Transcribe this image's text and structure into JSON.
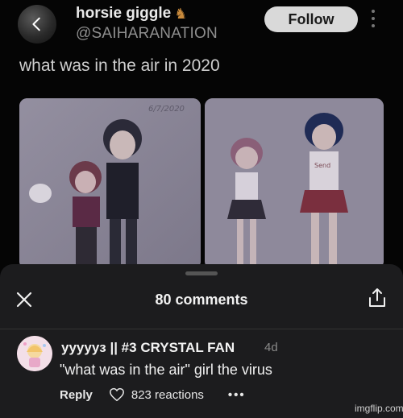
{
  "post": {
    "author_name": "horsie giggle",
    "author_icon": "horse-emoji",
    "handle": "@SAIHARANATION",
    "follow_label": "Follow",
    "text": "what was in the air in 2020",
    "image_caption": "6/7/2020",
    "shirt_text": "Send"
  },
  "comments_sheet": {
    "title": "80 comments",
    "comment": {
      "username": "yyyyyɜ || #3 CRYSTAL FAN",
      "time": "4d",
      "text": "\"what was in the air\" girl the virus",
      "reply_label": "Reply",
      "reactions": "823 reactions",
      "more_label": "•••"
    }
  },
  "watermark": "imgflip.com",
  "colors": {
    "sheet_bg": "#1c1c1e",
    "follow_bg": "#d9d9d9",
    "image_bg": "#8a8595"
  }
}
